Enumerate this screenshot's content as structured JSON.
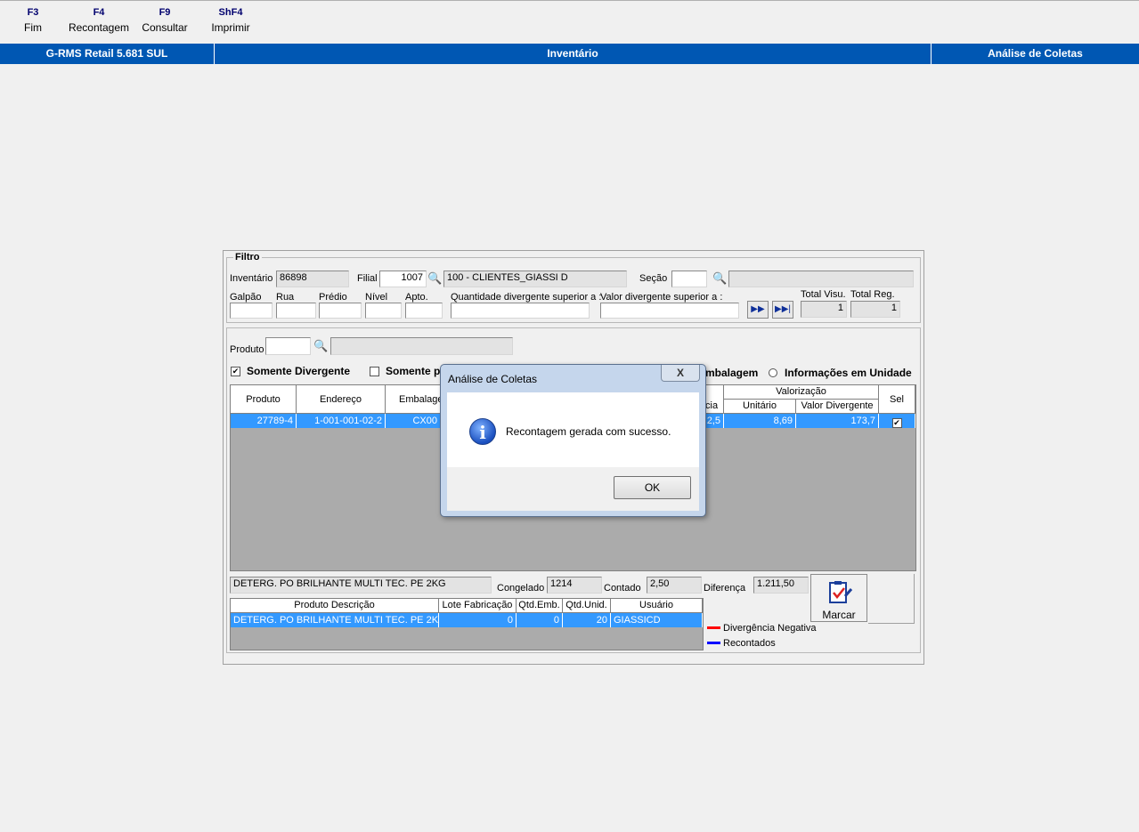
{
  "toolbar": {
    "keys": [
      {
        "key": "F3",
        "label": "Fim"
      },
      {
        "key": "F4",
        "label": "Recontagem"
      },
      {
        "key": "F9",
        "label": "Consultar"
      },
      {
        "key": "ShF4",
        "label": "Imprimir"
      }
    ]
  },
  "titlebar": {
    "app": "G-RMS Retail 5.681 SUL",
    "module": "Inventário",
    "screen": "Análise de Coletas"
  },
  "filtro": {
    "title": "Filtro",
    "inventario_label": "Inventário",
    "inventario_value": "86898",
    "filial_label": "Filial",
    "filial_value": "1007",
    "filial_desc": "100 - CLIENTES_GIASSI D",
    "secao_label": "Seção",
    "secao_value": "",
    "secao_desc": "",
    "galpao_label": "Galpão",
    "rua_label": "Rua",
    "predio_label": "Prédio",
    "nivel_label": "Nível",
    "apto_label": "Apto.",
    "qtd_div_label": "Quantidade divergente superior a :",
    "valor_div_label": "Valor divergente superior a :",
    "total_visu_label": "Total Visu.",
    "total_visu_value": "1",
    "total_reg_label": "Total Reg.",
    "total_reg_value": "1"
  },
  "produto": {
    "label": "Produto",
    "value": "",
    "desc": ""
  },
  "options": {
    "somente_divergente": "Somente Divergente",
    "somente_p": "Somente p",
    "embalagem": "mbalagem",
    "info_unidade": "Informações em Unidade"
  },
  "grid": {
    "headers": {
      "produto": "Produto",
      "endereco": "Endereço",
      "embalagem": "Embalage",
      "diferenca_partial": "cia",
      "valorizacao": "Valorização",
      "unitario": "Unitário",
      "valor_divergente": "Valor Divergente",
      "sel": "Sel"
    },
    "row": {
      "produto": "27789-4",
      "endereco": "1-001-001-02-2",
      "embalagem": "CX00",
      "diferenca": "2,5",
      "unitario": "8,69",
      "valor_divergente": "173,7"
    }
  },
  "detail": {
    "descricao": "DETERG. PO BRILHANTE MULTI TEC. PE   2KG",
    "congelado_label": "Congelado",
    "congelado_value": "1214",
    "contado_label": "Contado",
    "contado_value": "2,50",
    "diferenca_label": "Diferença",
    "diferenca_value": "1.211,50",
    "marcar_label": "Marcar"
  },
  "subgrid": {
    "headers": [
      "Produto Descrição",
      "Lote Fabricação",
      "Qtd.Emb.",
      "Qtd.Unid.",
      "Usuário"
    ],
    "row": [
      "DETERG. PO BRILHANTE MULTI TEC. PE   2K",
      "0",
      "0",
      "20",
      "GIASSICD"
    ]
  },
  "legend": [
    {
      "label": "Divergência Negativa",
      "color": "#ff0000"
    },
    {
      "label": "Recontados",
      "color": "#0000ff"
    }
  ],
  "dialog": {
    "title": "Análise de Coletas",
    "close": "X",
    "message": "Recontagem gerada com sucesso.",
    "ok": "OK"
  },
  "colors": {
    "titlebar": "#0057b3",
    "selection": "#3399ff",
    "grid_bg": "#ababab"
  }
}
